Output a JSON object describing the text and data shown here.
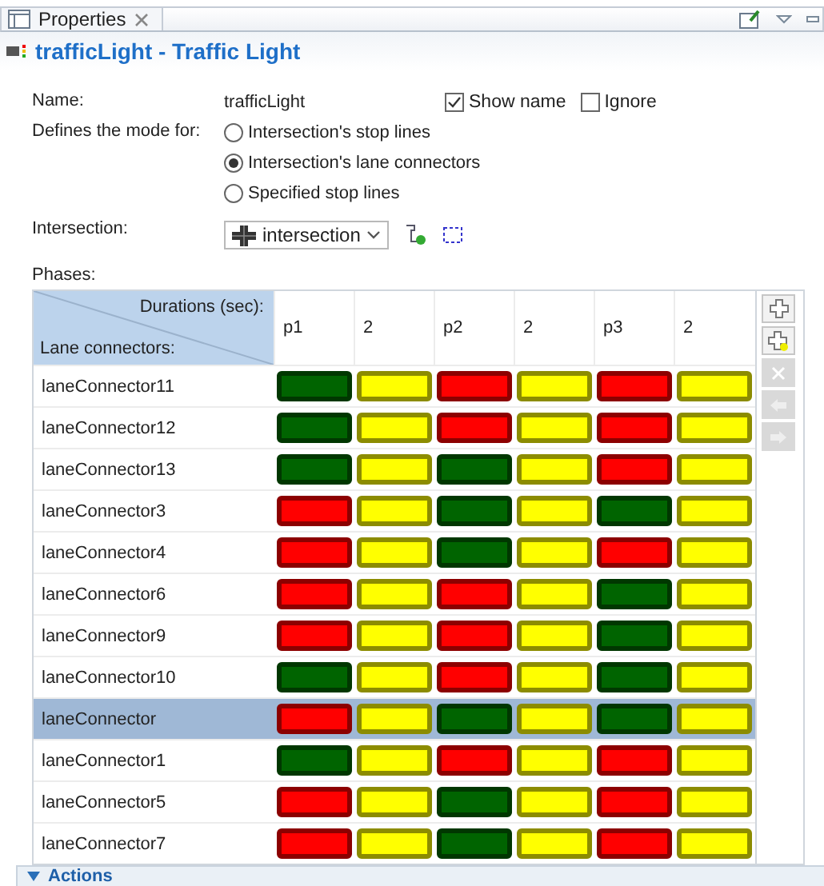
{
  "tab": {
    "label": "Properties"
  },
  "header": {
    "title": "trafficLight - Traffic Light"
  },
  "form": {
    "name_label": "Name:",
    "name_value": "trafficLight",
    "checkboxes": [
      {
        "label": "Show name",
        "checked": true
      },
      {
        "label": "Ignore",
        "checked": false
      }
    ],
    "mode_label": "Defines the mode for:",
    "modes": [
      {
        "label": "Intersection's stop lines",
        "selected": false
      },
      {
        "label": "Intersection's lane connectors",
        "selected": true
      },
      {
        "label": "Specified stop lines",
        "selected": false
      }
    ],
    "intersection_label": "Intersection:",
    "intersection_value": "intersection"
  },
  "phases": {
    "label": "Phases:",
    "corner_top": "Durations (sec):",
    "corner_bottom": "Lane connectors:",
    "columns": [
      "p1",
      "2",
      "p2",
      "2",
      "p3",
      "2"
    ],
    "rows": [
      {
        "name": "laneConnector11",
        "selected": false,
        "cells": [
          {
            "color": "#006400"
          },
          {
            "color": "#ffff00"
          },
          {
            "color": "#ff0000"
          },
          {
            "color": "#ffff00"
          },
          {
            "color": "#ff0000"
          },
          {
            "color": "#ffff00"
          }
        ]
      },
      {
        "name": "laneConnector12",
        "selected": false,
        "cells": [
          {
            "color": "#006400"
          },
          {
            "color": "#ffff00"
          },
          {
            "color": "#ff0000"
          },
          {
            "color": "#ffff00"
          },
          {
            "color": "#ff0000"
          },
          {
            "color": "#ffff00"
          }
        ]
      },
      {
        "name": "laneConnector13",
        "selected": false,
        "cells": [
          {
            "color": "#006400"
          },
          {
            "color": "#ffff00"
          },
          {
            "color": "#006400"
          },
          {
            "color": "#ffff00"
          },
          {
            "color": "#ff0000"
          },
          {
            "color": "#ffff00"
          }
        ]
      },
      {
        "name": "laneConnector3",
        "selected": false,
        "cells": [
          {
            "color": "#ff0000"
          },
          {
            "color": "#ffff00"
          },
          {
            "color": "#006400"
          },
          {
            "color": "#ffff00"
          },
          {
            "color": "#006400"
          },
          {
            "color": "#ffff00"
          }
        ]
      },
      {
        "name": "laneConnector4",
        "selected": false,
        "cells": [
          {
            "color": "#ff0000"
          },
          {
            "color": "#ffff00"
          },
          {
            "color": "#006400"
          },
          {
            "color": "#ffff00"
          },
          {
            "color": "#ff0000"
          },
          {
            "color": "#ffff00"
          }
        ]
      },
      {
        "name": "laneConnector6",
        "selected": false,
        "cells": [
          {
            "color": "#ff0000"
          },
          {
            "color": "#ffff00"
          },
          {
            "color": "#ff0000"
          },
          {
            "color": "#ffff00"
          },
          {
            "color": "#006400"
          },
          {
            "color": "#ffff00"
          }
        ]
      },
      {
        "name": "laneConnector9",
        "selected": false,
        "cells": [
          {
            "color": "#ff0000"
          },
          {
            "color": "#ffff00"
          },
          {
            "color": "#ff0000"
          },
          {
            "color": "#ffff00"
          },
          {
            "color": "#006400"
          },
          {
            "color": "#ffff00"
          }
        ]
      },
      {
        "name": "laneConnector10",
        "selected": false,
        "cells": [
          {
            "color": "#006400"
          },
          {
            "color": "#ffff00"
          },
          {
            "color": "#ff0000"
          },
          {
            "color": "#ffff00"
          },
          {
            "color": "#006400"
          },
          {
            "color": "#ffff00"
          }
        ]
      },
      {
        "name": "laneConnector",
        "selected": true,
        "cells": [
          {
            "color": "#ff0000"
          },
          {
            "color": "#ffff00"
          },
          {
            "color": "#006400"
          },
          {
            "color": "#ffff00"
          },
          {
            "color": "#006400"
          },
          {
            "color": "#ffff00"
          }
        ]
      },
      {
        "name": "laneConnector1",
        "selected": false,
        "cells": [
          {
            "color": "#006400"
          },
          {
            "color": "#ffff00"
          },
          {
            "color": "#ff0000"
          },
          {
            "color": "#ffff00"
          },
          {
            "color": "#ff0000"
          },
          {
            "color": "#ffff00"
          }
        ]
      },
      {
        "name": "laneConnector5",
        "selected": false,
        "cells": [
          {
            "color": "#ff0000"
          },
          {
            "color": "#ffff00"
          },
          {
            "color": "#006400"
          },
          {
            "color": "#ffff00"
          },
          {
            "color": "#ff0000"
          },
          {
            "color": "#ffff00"
          }
        ]
      },
      {
        "name": "laneConnector7",
        "selected": false,
        "cells": [
          {
            "color": "#ff0000"
          },
          {
            "color": "#ffff00"
          },
          {
            "color": "#006400"
          },
          {
            "color": "#ffff00"
          },
          {
            "color": "#ff0000"
          },
          {
            "color": "#ffff00"
          }
        ]
      }
    ],
    "side_buttons": [
      {
        "kind": "add",
        "disabled": false
      },
      {
        "kind": "add-after",
        "disabled": false
      },
      {
        "kind": "remove",
        "disabled": true
      },
      {
        "kind": "left",
        "disabled": true
      },
      {
        "kind": "right",
        "disabled": true
      }
    ]
  },
  "actions": {
    "label": "Actions",
    "expanded": true
  }
}
